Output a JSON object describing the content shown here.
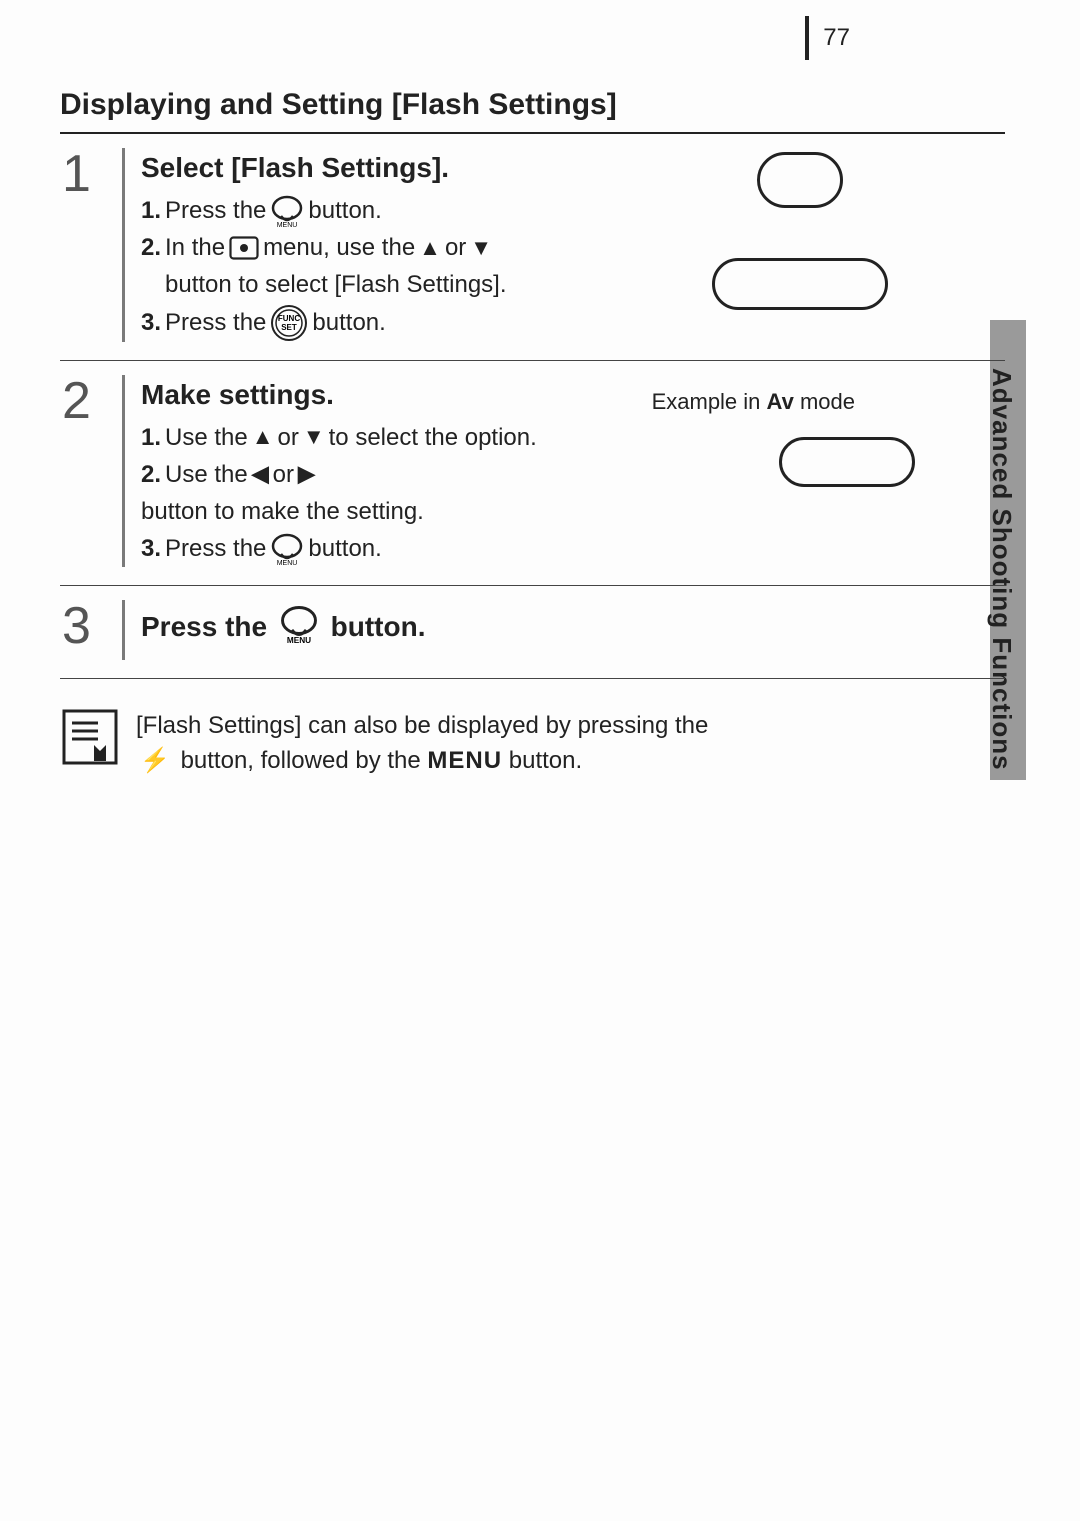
{
  "page_number": "77",
  "side_label": "Advanced Shooting Functions",
  "heading": "Displaying and Setting [Flash Settings]",
  "steps": [
    {
      "num": "1",
      "title": "Select [Flash Settings].",
      "items": {
        "i1a": "1.",
        "i1b": "Press the ",
        "i1c": " button.",
        "i2a": "2.",
        "i2b": "In the ",
        "i2c": " menu, use the ",
        "i2d": " or ",
        "i2e": " button to select [Flash Settings].",
        "i3a": "3.",
        "i3b": "Press the ",
        "i3c": " button."
      }
    },
    {
      "num": "2",
      "title": "Make settings.",
      "example_pre": "Example in ",
      "example_mode": "Av",
      "example_post": " mode",
      "items": {
        "i1a": "1.",
        "i1b": "Use the ",
        "i1c": " or ",
        "i1d": " to select the option.",
        "i2a": "2.",
        "i2b": "Use the ",
        "i2c": " or ",
        "i2d": " button to make the setting.",
        "i3a": "3.",
        "i3b": "Press the ",
        "i3c": " button."
      }
    },
    {
      "num": "3",
      "title_pre": "Press the ",
      "title_post": "button."
    }
  ],
  "tip": {
    "line1": "[Flash Settings] can also be displayed by pressing the ",
    "line2a": " button, followed by the ",
    "line2b": "MENU",
    "line2c": " button."
  },
  "icons": {
    "menu_label": "MENU",
    "func_top": "FUNC",
    "func_bot": "SET",
    "flash": "⚡"
  }
}
